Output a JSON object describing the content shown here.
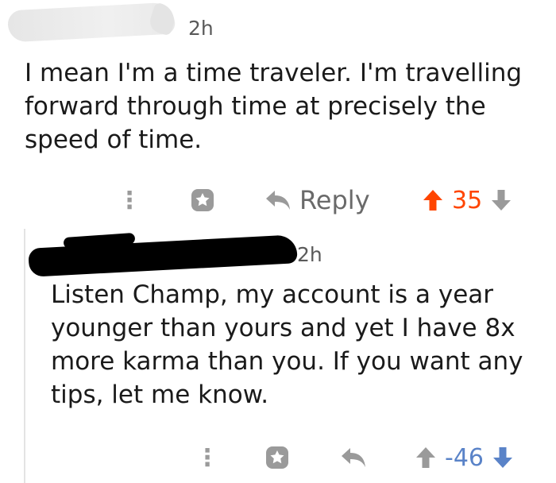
{
  "colors": {
    "upvote_active": "#ff4500",
    "downvote_active": "#5a83c8",
    "icon_gray": "#9a9a9a"
  },
  "comments": [
    {
      "time": "2h",
      "body": "I mean I'm a time traveler. I'm travelling\nforward through time at precisely the\nspeed of time.",
      "reply_label": "Reply",
      "score": "35",
      "vote_state": "upvoted",
      "icons": [
        "more-icon",
        "award-icon",
        "reply-icon",
        "upvote-icon",
        "downvote-icon"
      ]
    },
    {
      "time": "2h",
      "body": "Listen Champ, my account is a year\nyounger than yours and yet I have 8x\nmore karma than you. If you want any\ntips, let me know.",
      "score": "-46",
      "vote_state": "downvoted",
      "icons": [
        "more-icon",
        "award-icon",
        "reply-icon",
        "upvote-icon",
        "downvote-icon"
      ]
    }
  ]
}
